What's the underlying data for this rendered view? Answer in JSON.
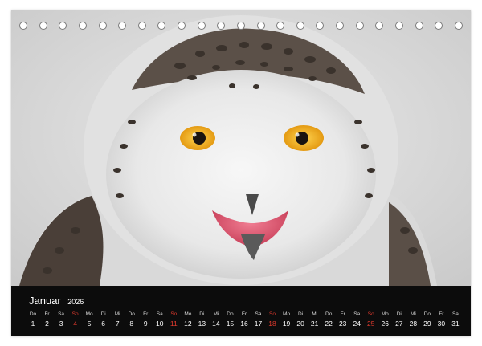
{
  "calendar": {
    "month": "Januar",
    "year": "2026",
    "accent_sunday": "#e43b2e",
    "bar_color": "#0c0c0c",
    "days": [
      {
        "wd": "Do",
        "d": "1",
        "sun": false
      },
      {
        "wd": "Fr",
        "d": "2",
        "sun": false
      },
      {
        "wd": "Sa",
        "d": "3",
        "sun": false
      },
      {
        "wd": "So",
        "d": "4",
        "sun": true
      },
      {
        "wd": "Mo",
        "d": "5",
        "sun": false
      },
      {
        "wd": "Di",
        "d": "6",
        "sun": false
      },
      {
        "wd": "Mi",
        "d": "7",
        "sun": false
      },
      {
        "wd": "Do",
        "d": "8",
        "sun": false
      },
      {
        "wd": "Fr",
        "d": "9",
        "sun": false
      },
      {
        "wd": "Sa",
        "d": "10",
        "sun": false
      },
      {
        "wd": "So",
        "d": "11",
        "sun": true
      },
      {
        "wd": "Mo",
        "d": "12",
        "sun": false
      },
      {
        "wd": "Di",
        "d": "13",
        "sun": false
      },
      {
        "wd": "Mi",
        "d": "14",
        "sun": false
      },
      {
        "wd": "Do",
        "d": "15",
        "sun": false
      },
      {
        "wd": "Fr",
        "d": "16",
        "sun": false
      },
      {
        "wd": "Sa",
        "d": "17",
        "sun": false
      },
      {
        "wd": "So",
        "d": "18",
        "sun": true
      },
      {
        "wd": "Mo",
        "d": "19",
        "sun": false
      },
      {
        "wd": "Di",
        "d": "20",
        "sun": false
      },
      {
        "wd": "Mi",
        "d": "21",
        "sun": false
      },
      {
        "wd": "Do",
        "d": "22",
        "sun": false
      },
      {
        "wd": "Fr",
        "d": "23",
        "sun": false
      },
      {
        "wd": "Sa",
        "d": "24",
        "sun": false
      },
      {
        "wd": "So",
        "d": "25",
        "sun": true
      },
      {
        "wd": "Mo",
        "d": "26",
        "sun": false
      },
      {
        "wd": "Di",
        "d": "27",
        "sun": false
      },
      {
        "wd": "Mi",
        "d": "28",
        "sun": false
      },
      {
        "wd": "Do",
        "d": "29",
        "sun": false
      },
      {
        "wd": "Fr",
        "d": "30",
        "sun": false
      },
      {
        "wd": "Sa",
        "d": "31",
        "sun": false
      }
    ]
  },
  "photo": {
    "subject": "snowy-owl",
    "eye_color": "#f0b21e",
    "beak_open_color": "#e0607a",
    "background_color": "#dedede"
  },
  "binding": {
    "hole_count": 23
  }
}
